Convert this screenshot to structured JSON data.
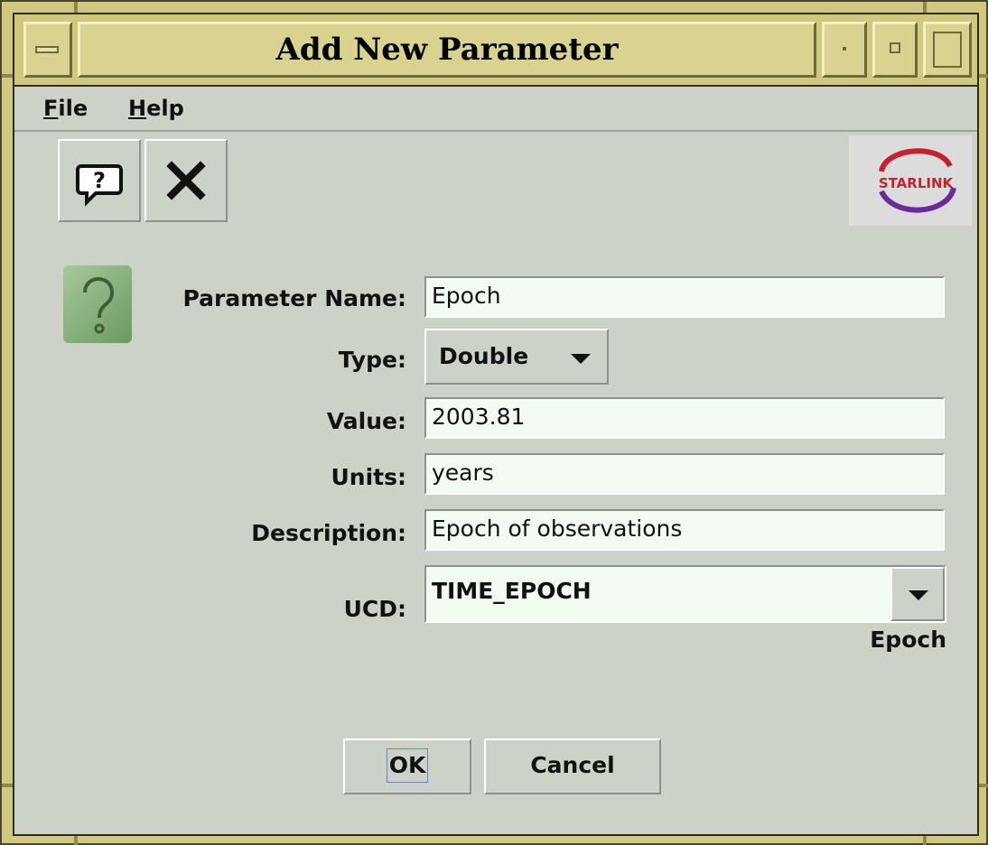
{
  "window": {
    "title": "Add New Parameter"
  },
  "menu": {
    "file": "File",
    "help": "Help",
    "file_mnemonic": "F",
    "file_rest": "ile",
    "help_mnemonic": "H",
    "help_rest": "elp"
  },
  "toolbar": {
    "help_icon": "question-bubble-icon",
    "close_icon": "close-x-icon"
  },
  "logo": {
    "text": "STARLINK"
  },
  "form": {
    "name_label": "Parameter Name:",
    "name_value": "Epoch",
    "type_label": "Type:",
    "type_value": "Double",
    "value_label": "Value:",
    "value_value": "2003.81",
    "units_label": "Units:",
    "units_value": "years",
    "description_label": "Description:",
    "description_value": "Epoch of observations",
    "ucd_label": "UCD:",
    "ucd_value": "TIME_EPOCH",
    "ucd_description": "Epoch"
  },
  "buttons": {
    "ok": "OK",
    "cancel": "Cancel"
  }
}
